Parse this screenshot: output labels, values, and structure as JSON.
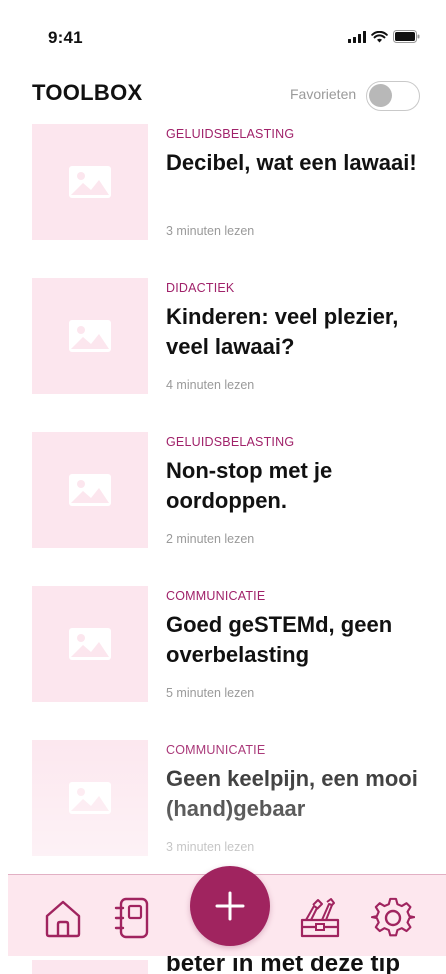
{
  "status": {
    "time": "9:41"
  },
  "header": {
    "title": "TOOLBOX",
    "favorites_label": "Favorieten",
    "favorites_on": false
  },
  "articles": [
    {
      "category": "GELUIDSBELASTING",
      "title": "Decibel, wat een lawaai!",
      "read_time": "3 minuten lezen",
      "image": "image-placeholder-icon"
    },
    {
      "category": "DIDACTIEK",
      "title": "Kinderen: veel plezier, veel lawaai?",
      "read_time": "4 minuten lezen",
      "image": "image-placeholder-icon"
    },
    {
      "category": "GELUIDSBELASTING",
      "title": "Non-stop met je oordoppen.",
      "read_time": "2 minuten lezen",
      "image": "image-placeholder-icon"
    },
    {
      "category": "COMMUNICATIE",
      "title": "Goed geSTEMd, geen overbelasting",
      "read_time": "5 minuten lezen",
      "image": "image-placeholder-icon"
    },
    {
      "category": "COMMUNICATIE",
      "title": "Geen keelpijn, een mooi (hand)gebaar",
      "read_time": "3 minuten lezen",
      "image": "image-placeholder-icon"
    }
  ],
  "partial_article": {
    "title_fragment": "beter in met deze tip"
  },
  "tabbar": {
    "items": [
      "home-icon",
      "notebook-icon",
      "add-icon",
      "toolbox-icon",
      "settings-icon"
    ]
  },
  "colors": {
    "accent": "#a0245f",
    "category": "#a0226a",
    "thumb": "#fce6ee",
    "tabbar": "#fde7ee"
  }
}
